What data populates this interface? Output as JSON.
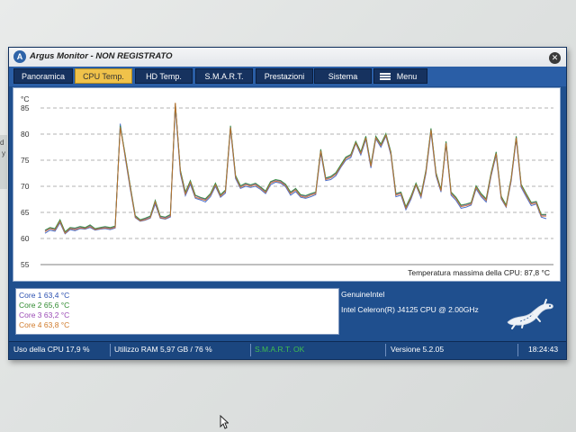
{
  "window": {
    "title": "Argus Monitor - NON REGISTRATO",
    "close_glyph": "✕"
  },
  "tabs": [
    {
      "label": "Panoramica",
      "active": false
    },
    {
      "label": "CPU Temp.",
      "active": true
    },
    {
      "label": "HD Temp.",
      "active": false
    },
    {
      "label": "S.M.A.R.T.",
      "active": false
    },
    {
      "label": "Prestazioni",
      "active": false
    },
    {
      "label": "Sistema",
      "active": false
    },
    {
      "label": "Menu",
      "active": false,
      "icon": "hamburger-menu-icon"
    }
  ],
  "chart_data": {
    "type": "line",
    "unit_label": "°C",
    "ylim": [
      55,
      85
    ],
    "yticks": [
      55,
      60,
      65,
      70,
      75,
      80,
      85
    ],
    "grid": "dashed horizontal",
    "max_text": "Temperatura massima della CPU: 87,8 °C",
    "series": [
      {
        "color": "#7a3fbf",
        "values": [
          61.5,
          62,
          61.8,
          63.5,
          61.2,
          62,
          61.9,
          62.2,
          62,
          62.5,
          61.8,
          62,
          62.2,
          62,
          62.3,
          81.5,
          76,
          70,
          64.3,
          63.5,
          63.8,
          64.2,
          67.2,
          64.2,
          64,
          64.5,
          85.8,
          73,
          68.8,
          71,
          68.2,
          67.8,
          67.5,
          68.5,
          70.5,
          68.3,
          69.2,
          81.5,
          72,
          70,
          70.5,
          70.2,
          70.5,
          69.8,
          69,
          70.8,
          71.2,
          71,
          70.3,
          68.8,
          69.5,
          68.3,
          68.1,
          68.5,
          68.8,
          77,
          71.5,
          71.8,
          72.5,
          74,
          75.5,
          76,
          78.5,
          76.5,
          79.5,
          74,
          79.5,
          78,
          80,
          76.5,
          68.5,
          68.8,
          66,
          68,
          70.5,
          68.3,
          73,
          81,
          72.5,
          69.3,
          78.5,
          68.8,
          67.8,
          66.3,
          66.5,
          66.8,
          70,
          68.5,
          67.5,
          72.5,
          76.5,
          68,
          66.3,
          71.5,
          79.5,
          70.3,
          68.5,
          66.8,
          67,
          64.5,
          64.5
        ]
      },
      {
        "color": "#3a5fc8",
        "values": [
          61,
          61.6,
          61.4,
          63,
          60.9,
          61.7,
          61.5,
          61.9,
          61.8,
          62.1,
          61.6,
          61.8,
          61.9,
          61.7,
          62,
          82,
          75.5,
          69.5,
          64,
          63.3,
          63.5,
          63.9,
          66.6,
          63.9,
          63.7,
          64.1,
          85.2,
          72.4,
          68.2,
          70.4,
          67.7,
          67.4,
          67,
          68,
          70,
          67.9,
          68.7,
          81,
          71.5,
          69.6,
          70,
          69.8,
          70,
          69.4,
          68.6,
          70.3,
          70.8,
          70.6,
          69.9,
          68.3,
          69,
          67.9,
          67.7,
          68,
          68.4,
          76.4,
          71.1,
          71.3,
          72,
          73.6,
          75,
          75.5,
          78.2,
          76,
          79,
          73.5,
          79.1,
          77.5,
          79.6,
          76,
          68,
          68.3,
          65.5,
          67.5,
          70.2,
          67.8,
          72.5,
          80.4,
          72,
          68.9,
          78,
          68.3,
          67.3,
          65.8,
          66,
          66.4,
          69.5,
          68,
          67,
          72,
          76,
          67.6,
          66,
          71,
          79,
          69.8,
          68,
          66.3,
          66.6,
          64.1,
          63.8
        ]
      },
      {
        "color": "#2f8f3a",
        "values": [
          61.6,
          62.1,
          61.9,
          63.6,
          61.3,
          62.1,
          62,
          62.3,
          62.1,
          62.6,
          61.9,
          62.1,
          62.3,
          62.1,
          62.4,
          81.6,
          76.1,
          70.1,
          64.4,
          63.6,
          63.9,
          64.3,
          67.3,
          64.3,
          64.1,
          64.6,
          85.9,
          73.1,
          68.9,
          71.1,
          68.3,
          67.9,
          67.6,
          68.6,
          70.6,
          68.4,
          69.3,
          81.6,
          72.1,
          70.1,
          70.6,
          70.3,
          70.6,
          69.9,
          69.1,
          70.9,
          71.3,
          71.1,
          70.4,
          68.9,
          69.6,
          68.4,
          68.2,
          68.6,
          68.9,
          77.1,
          71.6,
          71.9,
          72.6,
          74.1,
          75.6,
          76.1,
          78.6,
          76.6,
          79.6,
          74.1,
          79.6,
          78.1,
          80.1,
          76.6,
          68.6,
          68.9,
          66.1,
          68.1,
          70.6,
          68.4,
          73.1,
          81.1,
          72.6,
          69.4,
          78.6,
          68.9,
          67.9,
          66.4,
          66.6,
          66.9,
          70.1,
          68.6,
          67.6,
          72.6,
          76.6,
          68.1,
          66.4,
          71.6,
          79.6,
          70.4,
          68.6,
          66.9,
          67.1,
          64.6,
          64.6
        ]
      },
      {
        "color": "#c8702a",
        "values": [
          61.3,
          61.9,
          61.6,
          63.3,
          61,
          61.9,
          61.7,
          62,
          61.9,
          62.3,
          61.7,
          61.9,
          62,
          61.9,
          62.1,
          81.3,
          75.8,
          69.8,
          64.1,
          63.4,
          63.6,
          64,
          67,
          64,
          63.8,
          64.3,
          86,
          72.8,
          68.5,
          70.8,
          67.9,
          67.6,
          67.3,
          68.3,
          70.3,
          68.1,
          69,
          81.3,
          71.8,
          69.8,
          70.3,
          70,
          70.3,
          69.6,
          68.8,
          70.6,
          71,
          70.8,
          70.1,
          68.6,
          69.3,
          68.1,
          67.9,
          68.3,
          68.6,
          76.8,
          71.3,
          71.6,
          72.3,
          73.8,
          75.3,
          75.8,
          78.3,
          76.3,
          79.3,
          73.8,
          79.3,
          77.8,
          79.8,
          76.3,
          68.3,
          68.6,
          65.8,
          67.8,
          70.3,
          68.1,
          72.8,
          80.8,
          72.3,
          69.1,
          78.3,
          68.6,
          67.6,
          66.1,
          66.3,
          66.6,
          69.8,
          68.3,
          67.3,
          72.3,
          76.3,
          67.8,
          66.1,
          71.3,
          79.3,
          70.1,
          68.3,
          66.6,
          66.8,
          64.3,
          64.3
        ]
      }
    ]
  },
  "cores": [
    {
      "label": "Core 1 63,4 °C",
      "color": "#2a4fb0"
    },
    {
      "label": "Core 2 65,6 °C",
      "color": "#2f8a2f"
    },
    {
      "label": "Core 3 63,2 °C",
      "color": "#9a4ab5"
    },
    {
      "label": "Core 4 63,8 °C",
      "color": "#d07a2a"
    }
  ],
  "cpu": {
    "vendor": "GenuineIntel",
    "name": "Intel Celeron(R) J4125 CPU @ 2.00GHz"
  },
  "status": {
    "cpu_usage": "Uso della CPU 17,9 %",
    "ram_usage": "Utilizzo RAM 5,97 GB / 76 %",
    "smart": "S.M.A.R.T. OK",
    "version": "Versione 5.2.05",
    "time": "18:24:43"
  },
  "colors": {
    "window_blue": "#1f4f8e",
    "active_tab": "#f0c24a",
    "smart_ok": "#3fbf4f"
  }
}
